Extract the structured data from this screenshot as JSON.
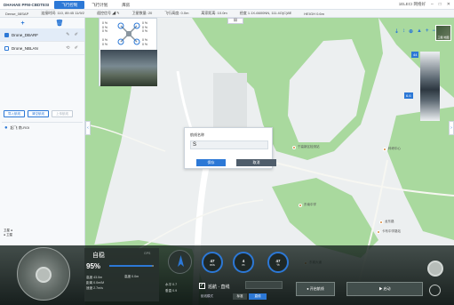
{
  "topbar": {
    "brand": "DHAHAE PFM-CBDTESI",
    "tabs": [
      "飞行控制",
      "飞行计划",
      "库房"
    ],
    "active_tab": 0,
    "right_text": "1ELECI 网络好",
    "minimize": "–",
    "maximize": "□",
    "close": "✕"
  },
  "status": {
    "items": [
      "Dense_08SAP",
      "连接时间: 110, 89:45 11/9/2",
      "遥控信号 ◢ ✎",
      "卫星数量: 20",
      "飞行高度: 0.0m",
      "离家距离: 10.0m",
      "经度 1.1X-6600NN, 111.4O(C)8E",
      "HEIGH 0.6m"
    ]
  },
  "left_panel": {
    "add_icon": "+",
    "delete_icon": "🗑",
    "drones": [
      {
        "name": "Drone_DBARF",
        "selected": true
      },
      {
        "name": "Drone_NBLAN",
        "selected": false
      }
    ],
    "buttons": [
      {
        "label": "导入航线",
        "enabled": true
      },
      {
        "label": "清空航线",
        "enabled": true
      },
      {
        "label": "上传航线",
        "enabled": false
      }
    ],
    "link_text": "起飞 南-ROI",
    "bottom_text_1": "卫星 ●",
    "bottom_text_2": "● 卫星"
  },
  "video": {
    "stat_tl": "0 %\n0 %\n0 %",
    "stat_tr": "0 %\n0 %\n0 %",
    "stat_bl": "0 %\n0 %",
    "stat_br": "0 %\n0 %"
  },
  "map": {
    "tools": [
      "⇣",
      "↕",
      "⊕",
      "▲",
      "+",
      "−"
    ],
    "layer_label": "卫星 地图",
    "top_control": "⊞",
    "gauge_top": "44",
    "gauge_mid": "6.6",
    "pois": [
      "宁高新区检测站",
      "东南中学",
      "龙东路",
      "卡布中学路站",
      "东城大道",
      "科研中心"
    ]
  },
  "dialog": {
    "title": "航线名称",
    "input_value": "S",
    "ok_label": "保存",
    "cancel_label": "取消"
  },
  "control": {
    "mode_title": "自稳",
    "battery": "95%",
    "battery_fraction": 0.95,
    "line1": "高度 43.0m",
    "line1b": "高度 0.0m",
    "line2": "距离 0.0m/M",
    "line3": "速度 2.7m/s",
    "corner": "GPS",
    "small_stat_1": "水平   0.7",
    "small_stat_2": "垂直   0.9",
    "dials": [
      {
        "value": "47",
        "unit": "m/s"
      },
      {
        "value": "4",
        "unit": "m"
      },
      {
        "value": "47",
        "unit": "%"
      }
    ],
    "toggle_label": "巡航 · 直线",
    "seg_label": "航线模式",
    "seg_options": [
      "标准",
      "直线"
    ],
    "seg_selected": 1,
    "action_1": "● 开启航线",
    "action_2": "▶ 启动"
  },
  "colors": {
    "accent": "#2c78d6",
    "panel_dark": "#1a2422",
    "map_green": "#a9d99e",
    "road_white": "#ffffff"
  }
}
